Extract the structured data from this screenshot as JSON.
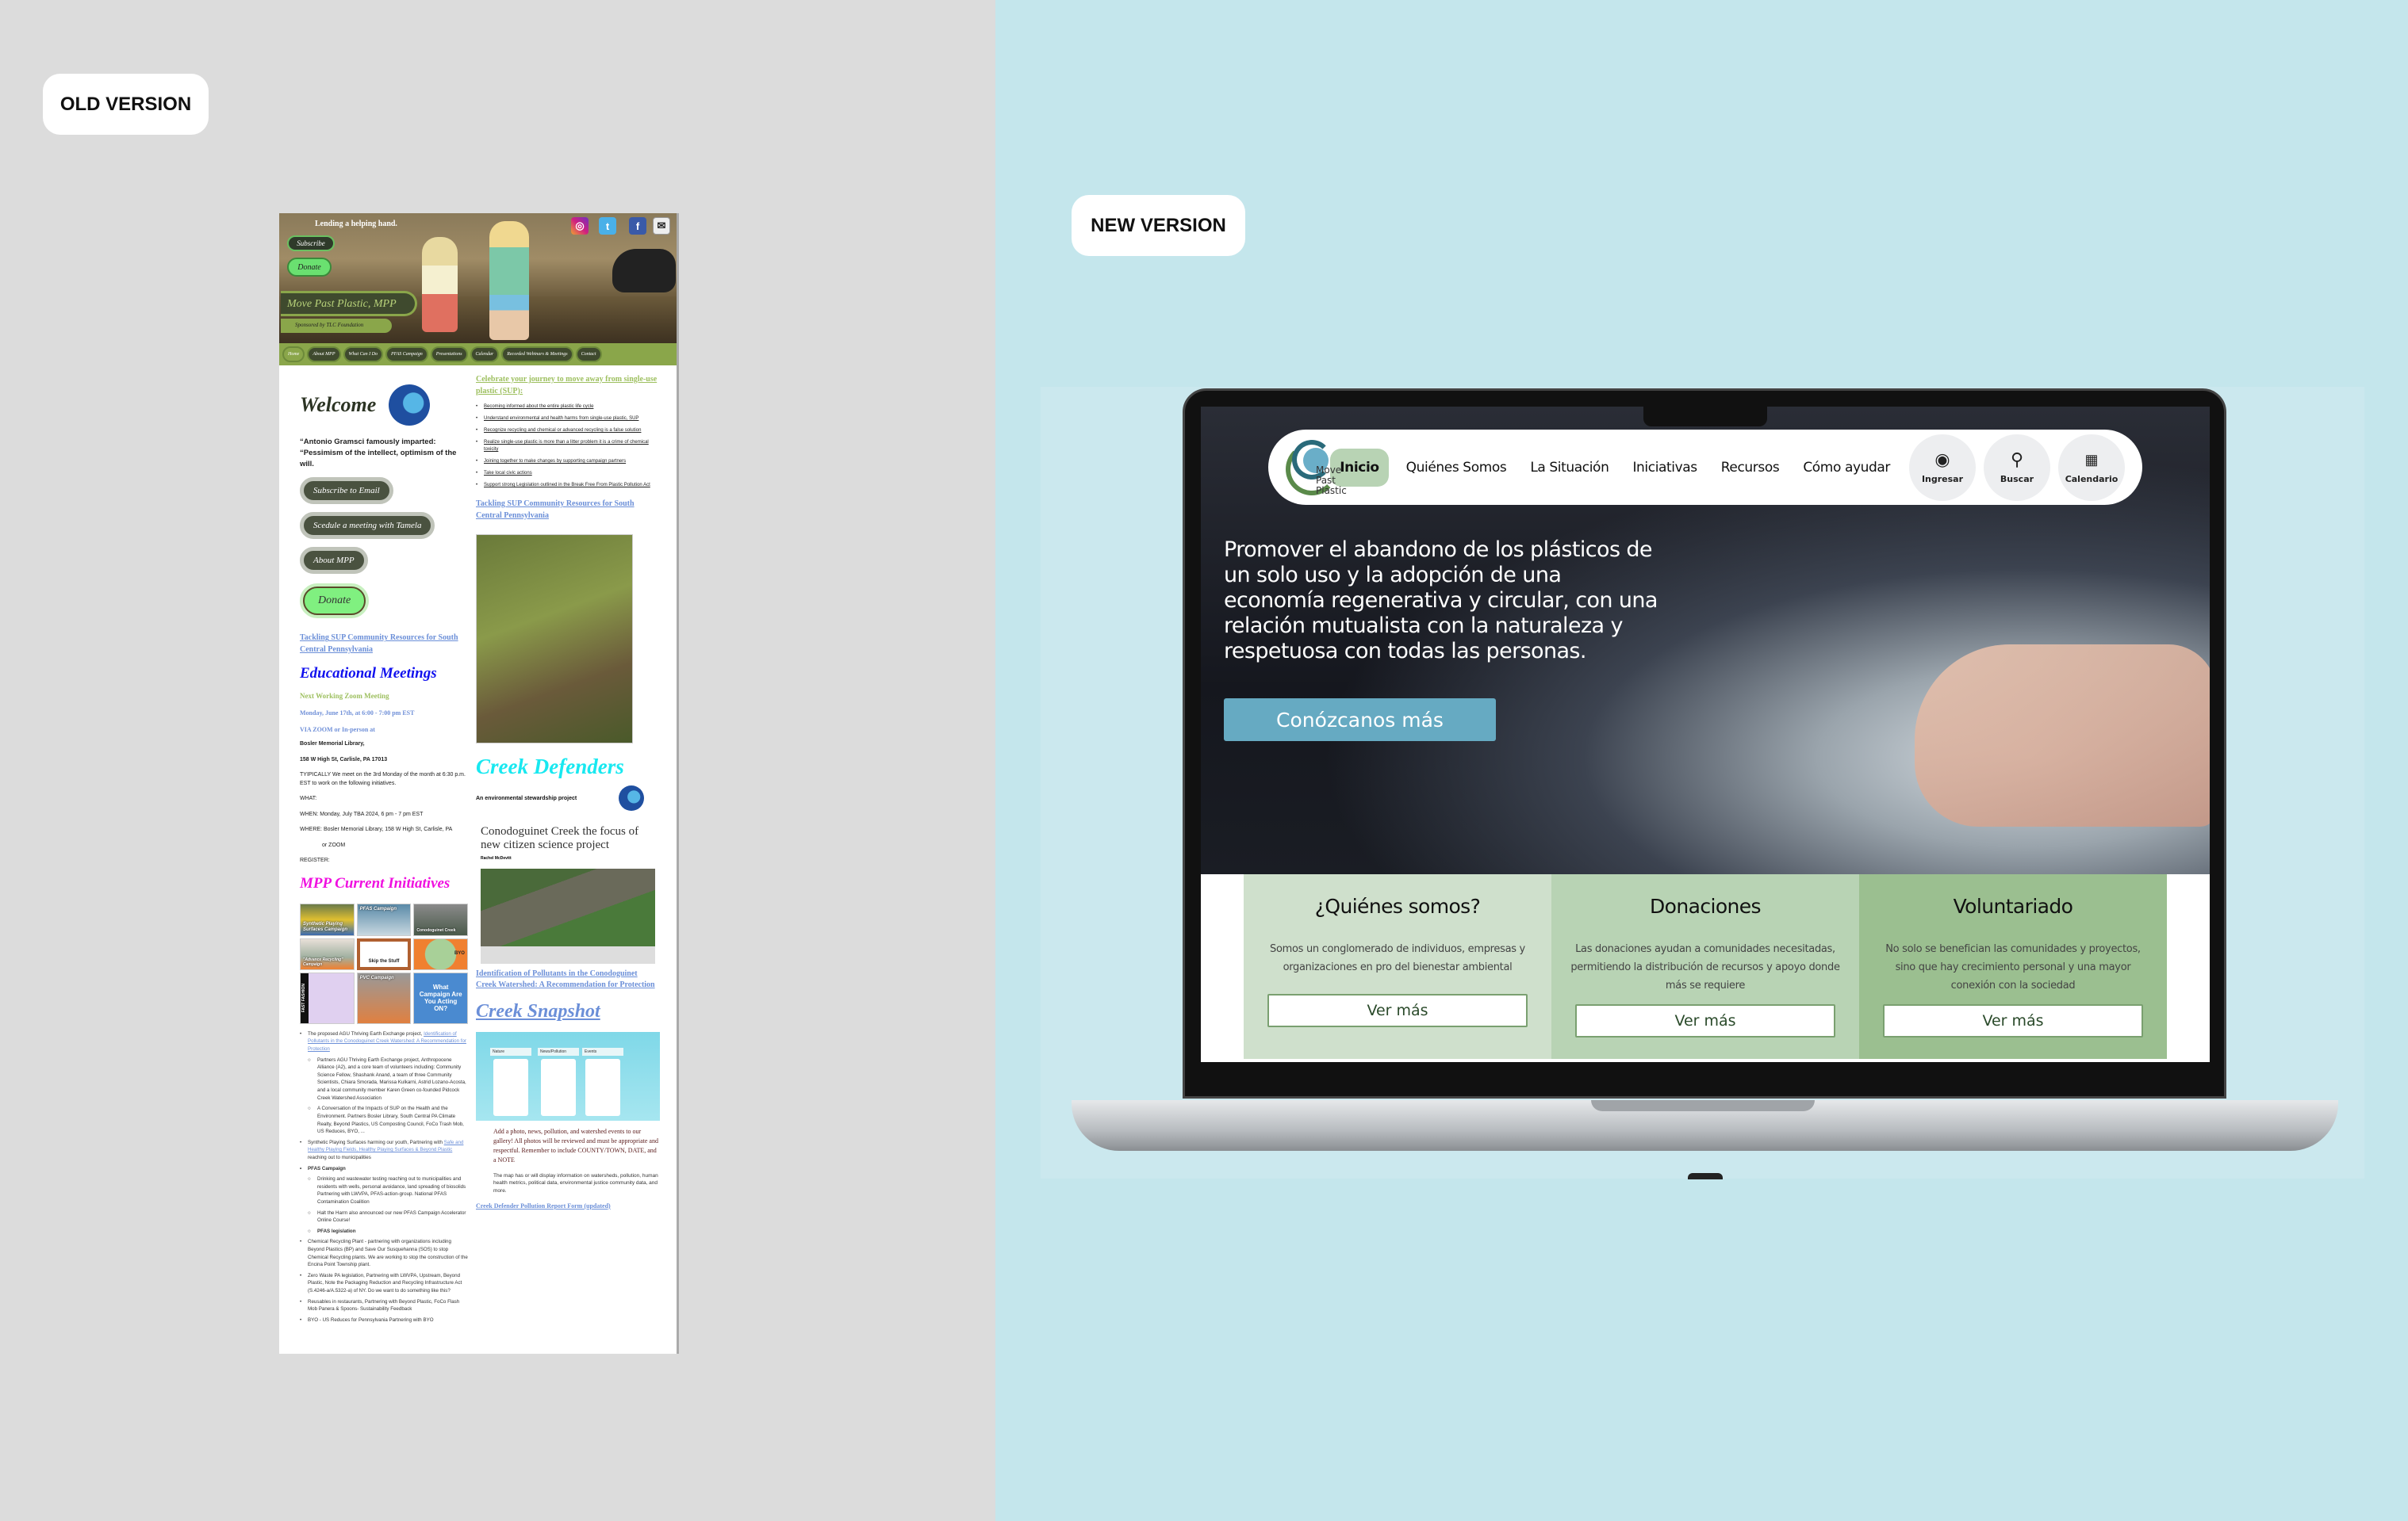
{
  "labels": {
    "old": "OLD VERSION",
    "new": "NEW VERSION"
  },
  "old_site": {
    "tagline": "Lending a helping hand.",
    "subscribe": "Subscribe",
    "donate": "Donate",
    "title": "Move Past Plastic, MPP",
    "sponsor": "Sponsored by TLC Foundation",
    "social_icons": [
      "instagram-icon",
      "twitter-icon",
      "facebook-icon",
      "email-icon"
    ],
    "nav": [
      "Home",
      "About MPP",
      "What Can I Do",
      "PFAS Campaign",
      "Presentations",
      "Calendar",
      "Recorded Webinars & Meetings",
      "Contact"
    ],
    "welcome": "Welcome",
    "logo_text": "Move Past Plastic",
    "quote": "“Antonio Gramsci famously imparted: “Pessimism of the intellect, optimism of the will.",
    "buttons": [
      "Subscribe to Email",
      "Scedule a meeting with Tamela",
      "About MPP"
    ],
    "donate_button": "Donate",
    "tackling_link": "Tackling SUP Community Resources for South Central Pennsylvania",
    "edu_heading": "Educational Meetings",
    "next_meeting": "Next Working Zoom Meeting",
    "meeting_date": "Monday, June 17th, at 6:00 - 7:00 pm EST",
    "via": "VIA ZOOM or In-person at",
    "library": "Bosler Memorial Library,",
    "address": "158 W High St, Carlisle, PA 17013",
    "typically": "TYIPICALLY  We meet on the 3rd Monday of the month at 6:30 p.m. EST to work on the following initiatives.",
    "what": "WHAT:",
    "when": "WHEN: Monday, July TBA  2024, 6 pm - 7 pm EST",
    "where": "WHERE: Bosler Memorial Library, 158 W High St, Carlisle, PA",
    "or_zoom": "or ZOOM",
    "register": "REGISTER:",
    "initiatives_heading": "MPP Current Initiatives",
    "tiles": [
      "Synthetic Playing Surfaces Campaign",
      "PFAS Campaign",
      "Conodoguinet Creek",
      "\"Advance Recycling\" Campaign",
      "Skip the Stuff",
      "BYO",
      "FAST FASHION",
      "PVC Campaign",
      "What Campaign Are You Acting ON?"
    ],
    "initiatives": {
      "i1": "The proposed AGU Thriving Earth Exchange project,",
      "i1_link": "Identification of Pollutants in the Conodoguinet Creek Watershed: A Recommendation for Protection",
      "i1_sub": "Partners AGU Thriving Earth Exchange project, Anthropocene Alliance (A2), and a core team of volunteers including: Community Science Fellow, Shashank Anand, a team of three Community Scientists, Chiara Smorada, Marissa Kulkarni, Astrid Lozano-Acosta, and a local community member Karen Green co-founded Pidcock Creek Watershed Association",
      "i1_conv": "A Conversation of the Impacts of SUP on the Health and the Environment.  Partners Bosler Library, South Central PA Climate Realty, Beyond Plastics, US Composting Council, FoCo Trash Mob, US Reduces, BYO, ...",
      "i2": "Synthetic Playing Surfaces harming our youth, Partnering with",
      "i2_links": "Safe and Healthy Playing Fields, Healthy Playing Surfaces & Beyond Plastic",
      "i2_end": "reaching out to municipalities",
      "i3": "PFAS Campaign",
      "i3_a": "Drinking and wastewater testing reaching out to municipalities and residents with wells, personal avoidance, land spreading of biosolids Partnering with LWVPA, PFAS-action-group. National PFAS Contamination Coalition",
      "i3_b": "Halt the Harm also announced our new PFAS Campaign Accelerator Online Course!",
      "i3_c": "PFAS legislation",
      "i4": "Chemical Recycling Plant - partnering with organizations including Beyond Plastics (BP) and Save Our Susquehanna (SOS) to stop Chemical Recycling plants. We are working to stop the construction of the Encina Point Township plant.",
      "i5": "Zero Waste PA legislation, Partnering with  LWVPA, Upstream, Beyond Plastic, Note the Packaging Reduction and Recycling Infrastructure Act (S.4246-a/A.5322-a) of NY.  Do we want to do something like this?",
      "i6": "Reusables in restaurants, Partnering with Beyond Plastic, FoCo Flash Mob Panera & Spoons- Sustainability Feedback",
      "i7": "BYO - US Reduces for Pennsylvania Partnering with BYO"
    },
    "celebrate": "Celebrate your journey to move away from single-use plastic (SUP):",
    "journey": [
      "Becoming informed about the entire plastic life cycle",
      "Understand environmental and health harms from single-use plastic, SUP",
      "Recognize recycling and chemical or advanced recycling is a false solution",
      "Realize single-use plastic is more than a litter problem it is a crime of chemical toxicity",
      "Joining together to make changes by supporting campaign partners",
      "Take local civic actions",
      "Support strong Legislation outlined in the Break Free From Plastic Pollution Act"
    ],
    "tackling_link_2": "Tackling SUP Community Resources for South Central Pennsylvania",
    "creek_defenders": "Creek Defenders",
    "stewardship": "An environmental stewardship project",
    "article_title": "Conodoguinet Creek the focus of new citizen science project",
    "article_author": "Rachel McDevitt",
    "identification_link": "Identification of Pollutants in the Conodoguinet Creek Watershed: A Recommendation for Protection",
    "creek_snapshot": "Creek Snapshot",
    "snapshot_columns": [
      "Nature",
      "News/Pollution",
      "Events"
    ],
    "gallery_note": "Add a photo, news, pollution, and watershed events to our gallery! All photos will be reviewed and must be appropriate and respectful. Remember to include COUNTY/TOWN, DATE, and a NOTE",
    "map_note": "The map has or will display information on watersheds, pollution, human health metrics, political data, environmental justice community data, and more.",
    "report_link": "Creek Defender Pollution Report Form (updated)"
  },
  "new_site": {
    "logo_text": [
      "Move",
      "Past",
      "Plastic"
    ],
    "nav": [
      "Inicio",
      "Quiénes Somos",
      "La Situación",
      "Iniciativas",
      "Recursos",
      "Cómo ayudar"
    ],
    "actions": [
      {
        "label": "Ingresar",
        "icon": "user-circle-icon"
      },
      {
        "label": "Buscar",
        "icon": "search-icon"
      },
      {
        "label": "Calendario",
        "icon": "calendar-icon"
      }
    ],
    "mission": "Promover el abandono de los plásticos de un solo uso y la adopción de una economía regenerativa y circular, con una relación mutualista con la naturaleza y respetuosa con todas las personas.",
    "cta": "Conózcanos más",
    "cards": [
      {
        "title": "¿Quiénes somos?",
        "text": "Somos un conglomerado de individuos, empresas y organizaciones en pro del bienestar ambiental",
        "button": "Ver más",
        "color": "#cfe0cc"
      },
      {
        "title": "Donaciones",
        "text": "Las donaciones ayudan a comunidades necesitadas, permitiendo la distribución de recursos y apoyo donde más se requiere",
        "button": "Ver más",
        "color": "#b8d3b4"
      },
      {
        "title": "Voluntariado",
        "text": "No solo se benefician las comunidades y proyectos, sino que hay crecimiento personal y una mayor conexión con la sociedad",
        "button": "Ver más",
        "color": "#9bbf90"
      }
    ],
    "accent": "#66aac2"
  }
}
